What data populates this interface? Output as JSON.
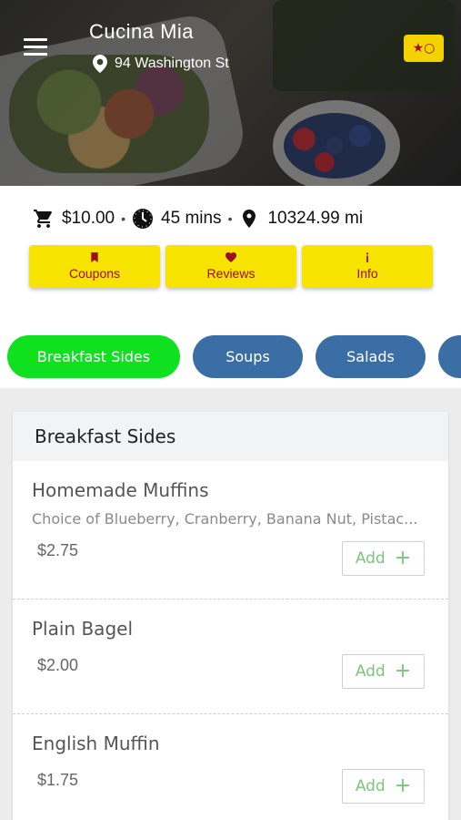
{
  "header": {
    "restaurant_name": "Cucina Mia",
    "address": "94 Washington St",
    "menu_icon": "hamburger-menu-icon",
    "pin_icon": "location-pin-icon",
    "favorite_icon": "star-circle-icon"
  },
  "info": {
    "minimum": "$10.00",
    "time": "45 mins",
    "distance": "10324.99 mi",
    "separator": "•",
    "cart_icon": "cart-icon",
    "clock_icon": "clock-icon",
    "pin_icon": "location-pin-icon"
  },
  "tabs": [
    {
      "label": "Coupons",
      "icon": "bookmark-icon"
    },
    {
      "label": "Reviews",
      "icon": "heart-icon"
    },
    {
      "label": "Info",
      "icon": "info-icon"
    }
  ],
  "categories": [
    {
      "label": "Breakfast Sides",
      "active": true
    },
    {
      "label": "Soups",
      "active": false
    },
    {
      "label": "Salads",
      "active": false
    },
    {
      "label": "",
      "active": false
    }
  ],
  "menu": {
    "section_title": "Breakfast Sides",
    "add_label": "Add",
    "items": [
      {
        "name": "Homemade Muffins",
        "description": "Choice of Blueberry, Cranberry, Banana Nut, Pistac...",
        "price": "$2.75"
      },
      {
        "name": "Plain Bagel",
        "description": "",
        "price": "$2.00"
      },
      {
        "name": "English Muffin",
        "description": "",
        "price": "$1.75"
      }
    ]
  },
  "colors": {
    "accent_yellow": "#f6e300",
    "tab_text_red": "#9b0e1d",
    "category_blue": "#3b6ea5",
    "category_active_green": "#0fe01f",
    "add_green": "#7cc47c"
  }
}
